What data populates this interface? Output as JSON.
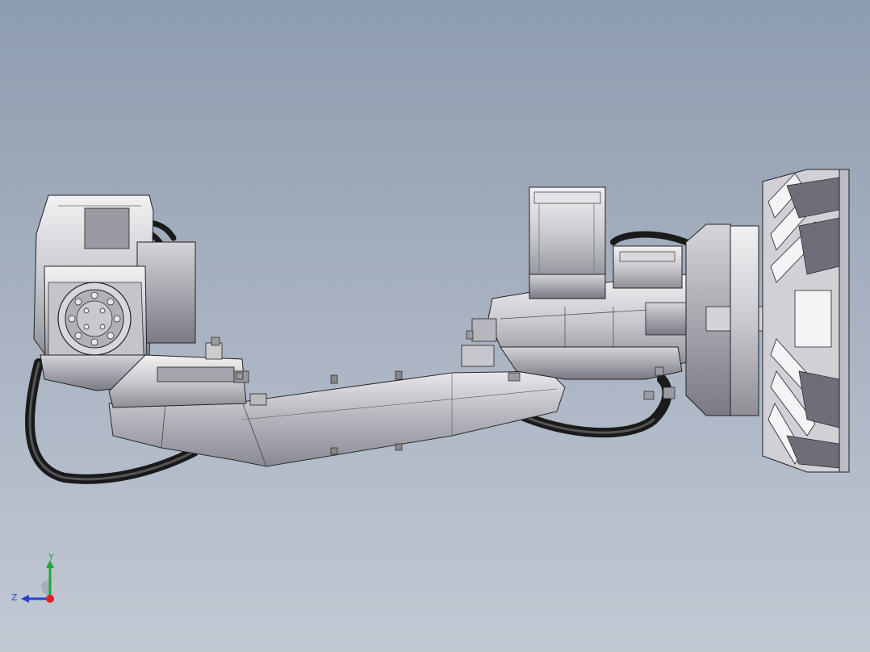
{
  "view": {
    "background_top": "#8e9cb0",
    "background_bottom": "#c2c9d3",
    "model": "robot-arm-assembly",
    "mode": "shaded-with-edges"
  },
  "triad": {
    "y_label": "Y",
    "z_label": "Z",
    "y_color": "#1fa83a",
    "z_color": "#2a3fd6",
    "x_color": "#e0202a"
  }
}
